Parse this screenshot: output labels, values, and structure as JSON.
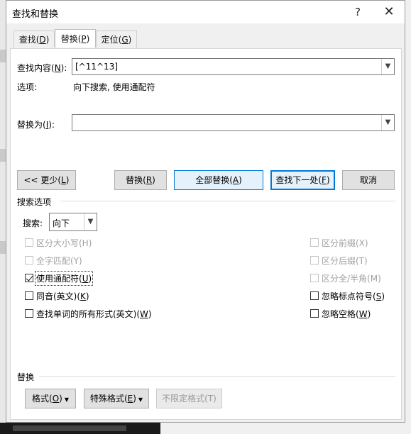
{
  "dialog": {
    "title": "查找和替换",
    "help": "?",
    "close": "✕"
  },
  "tabs": [
    {
      "label": "查找(D)",
      "text": "查找(",
      "key": "D",
      "end": ")"
    },
    {
      "label": "替换(P)",
      "text": "替换(",
      "key": "P",
      "end": ")"
    },
    {
      "label": "定位(G)",
      "text": "定位(",
      "key": "G",
      "end": ")"
    }
  ],
  "find": {
    "label_text": "查找内容(",
    "label_key": "N",
    "label_end": "):",
    "value": "[^11^13]",
    "options_label": "选项:",
    "options_value": "向下搜索, 使用通配符"
  },
  "replace": {
    "label_text": "替换为(",
    "label_key": "I",
    "label_end": "):",
    "value": ""
  },
  "buttons": {
    "less": {
      "text": "<< 更少(",
      "key": "L",
      "end": ")"
    },
    "replace": {
      "text": "替换(",
      "key": "R",
      "end": ")"
    },
    "replace_all": {
      "text": "全部替换(",
      "key": "A",
      "end": ")"
    },
    "find_next": {
      "text": "查找下一处(",
      "key": "F",
      "end": ")"
    },
    "cancel": "取消"
  },
  "search_options": {
    "section": "搜索选项",
    "search_label_text": "搜索",
    "search_label_key": "",
    "search_label_end": ":",
    "search_value": "向下"
  },
  "options_left": [
    {
      "text": "区分大小写(H)",
      "checked": false,
      "disabled": true
    },
    {
      "text": "全字匹配(Y)",
      "checked": false,
      "disabled": true
    },
    {
      "text": "使用通配符(",
      "key": "U",
      "end": ")",
      "checked": true,
      "disabled": false
    },
    {
      "text": "同音(英文)(",
      "key": "K",
      "end": ")",
      "checked": false,
      "disabled": false
    },
    {
      "text": "查找单词的所有形式(英文)(",
      "key": "W",
      "end": ")",
      "checked": false,
      "disabled": false
    }
  ],
  "options_right": [
    {
      "text": "区分前缀(X)",
      "checked": false,
      "disabled": true
    },
    {
      "text": "区分后缀(T)",
      "checked": false,
      "disabled": true
    },
    {
      "text": "区分全/半角(M)",
      "checked": false,
      "disabled": true
    },
    {
      "text": "忽略标点符号(",
      "key": "S",
      "end": ")",
      "checked": false,
      "disabled": false
    },
    {
      "text": "忽略空格(",
      "key": "W",
      "end": ")",
      "checked": false,
      "disabled": false
    }
  ],
  "replace_section": {
    "section": "替换",
    "format": {
      "text": "格式(",
      "key": "O",
      "end": ")"
    },
    "special": {
      "text": "特殊格式(",
      "key": "E",
      "end": ")"
    },
    "no_format": "不限定格式(T)"
  },
  "colors": {
    "accent": "#0078d7"
  }
}
